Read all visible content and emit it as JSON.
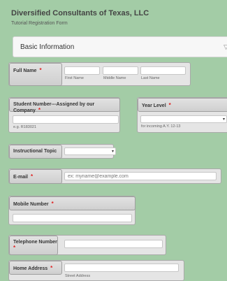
{
  "form": {
    "title": "Diversified Consultants of Texas, LLC",
    "subtitle": "Tutorial Registration Form"
  },
  "section": {
    "title": "Basic Information",
    "collapse_icon": "chevron-icon",
    "collapse_glyph": "▽"
  },
  "required_mark": "*",
  "fields": {
    "full_name": {
      "label": "Full Name",
      "sublabels": {
        "first": "First Name",
        "middle": "Middle Name",
        "last": "Last Name"
      }
    },
    "student_number": {
      "label": "Student Number---Assigned by our Company",
      "hint": "e.g. R183021"
    },
    "year_level": {
      "label": "Year Level",
      "hint": "for incoming A.Y. 12-13",
      "selected": "",
      "arrow_glyph": "▾"
    },
    "instructional_topic": {
      "label": "Instructional Topic",
      "selected": "",
      "arrow_glyph": "▾"
    },
    "email": {
      "label": "E-mail",
      "placeholder": "ex: myname@example.com"
    },
    "mobile": {
      "label": "Mobile Number"
    },
    "telephone": {
      "label": "Telephone Number"
    },
    "home_address": {
      "label": "Home Address",
      "sublabel": "Street Address"
    }
  },
  "colors": {
    "background": "#a3cca6",
    "required": "#e02020"
  }
}
